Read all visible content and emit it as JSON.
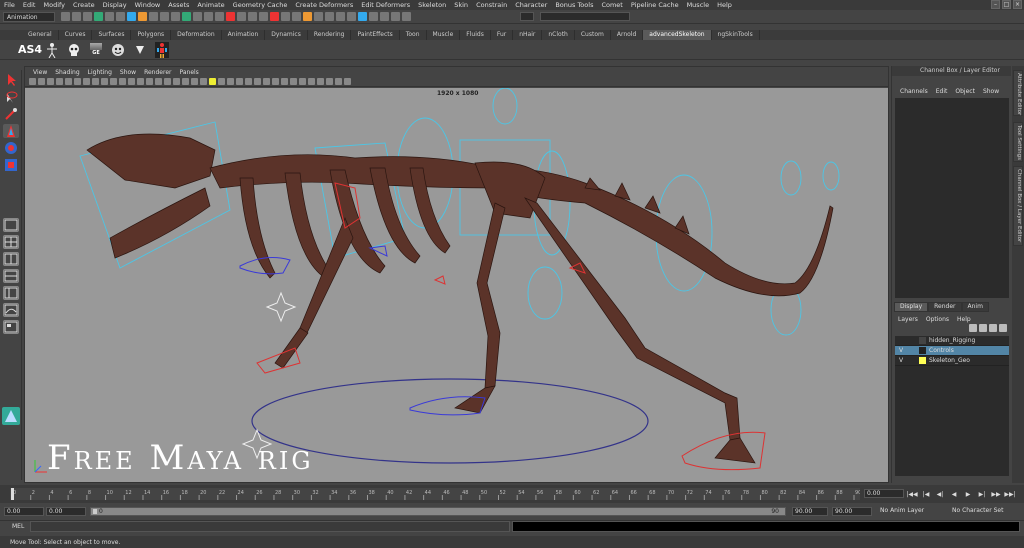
{
  "menubar": [
    "File",
    "Edit",
    "Modify",
    "Create",
    "Display",
    "Window",
    "Assets",
    "Animate",
    "Geometry Cache",
    "Create Deformers",
    "Edit Deformers",
    "Skeleton",
    "Skin",
    "Constrain",
    "Character",
    "Bonus Tools",
    "Comet",
    "Pipeline Cache",
    "Muscle",
    "Help"
  ],
  "status": {
    "menu_set": "Animation"
  },
  "shelf_tabs": [
    "General",
    "Curves",
    "Surfaces",
    "Polygons",
    "Deformation",
    "Animation",
    "Dynamics",
    "Rendering",
    "PaintEffects",
    "Toon",
    "Muscle",
    "Fluids",
    "Fur",
    "nHair",
    "nCloth",
    "Custom",
    "Arnold",
    "advancedSkeleton",
    "ngSkinTools"
  ],
  "active_shelf_tab": "advancedSkeleton",
  "shelf_icons": {
    "as4_label": "AS4",
    "ge_label": "GE"
  },
  "panel_menu": [
    "View",
    "Shading",
    "Lighting",
    "Show",
    "Renderer",
    "Panels"
  ],
  "viewport": {
    "resolution": "1920 x 1080",
    "watermark": "Free Maya rig"
  },
  "channel_box": {
    "title": "Channel Box / Layer Editor",
    "menu": [
      "Channels",
      "Edit",
      "Object",
      "Show"
    ]
  },
  "side_tabs": [
    "Attribute Editor",
    "Tool Settings",
    "Channel Box / Layer Editor"
  ],
  "layer_editor": {
    "tabs": [
      "Display",
      "Render",
      "Anim"
    ],
    "active_tab": "Display",
    "menu": [
      "Layers",
      "Options",
      "Help"
    ],
    "layers": [
      {
        "v": "",
        "p": "",
        "color": "#444444",
        "name": "hidden_Rigging",
        "selected": false
      },
      {
        "v": "V",
        "p": "",
        "color": "#222222",
        "name": "Controls",
        "selected": true
      },
      {
        "v": "V",
        "p": "",
        "color": "#ffff55",
        "name": "Skeleton_Geo",
        "selected": false
      }
    ]
  },
  "timeline": {
    "ticks": [
      "0",
      "2",
      "4",
      "6",
      "8",
      "10",
      "12",
      "14",
      "16",
      "18",
      "20",
      "22",
      "24",
      "26",
      "28",
      "30",
      "32",
      "34",
      "36",
      "38",
      "40",
      "42",
      "44",
      "46",
      "48",
      "50",
      "52",
      "54",
      "56",
      "58",
      "60",
      "62",
      "64",
      "66",
      "68",
      "70",
      "72",
      "74",
      "76",
      "78",
      "80",
      "82",
      "84",
      "86",
      "88",
      "90"
    ],
    "current_frame": "0.00"
  },
  "range": {
    "start": "0.00",
    "inner_start": "0.00",
    "handle_start": "0",
    "handle_end": "90",
    "inner_end": "90.00",
    "end": "90.00",
    "anim_layer": "No Anim Layer",
    "character_set": "No Character Set"
  },
  "mel_label": "MEL",
  "help_line": "Move Tool: Select an object to move."
}
